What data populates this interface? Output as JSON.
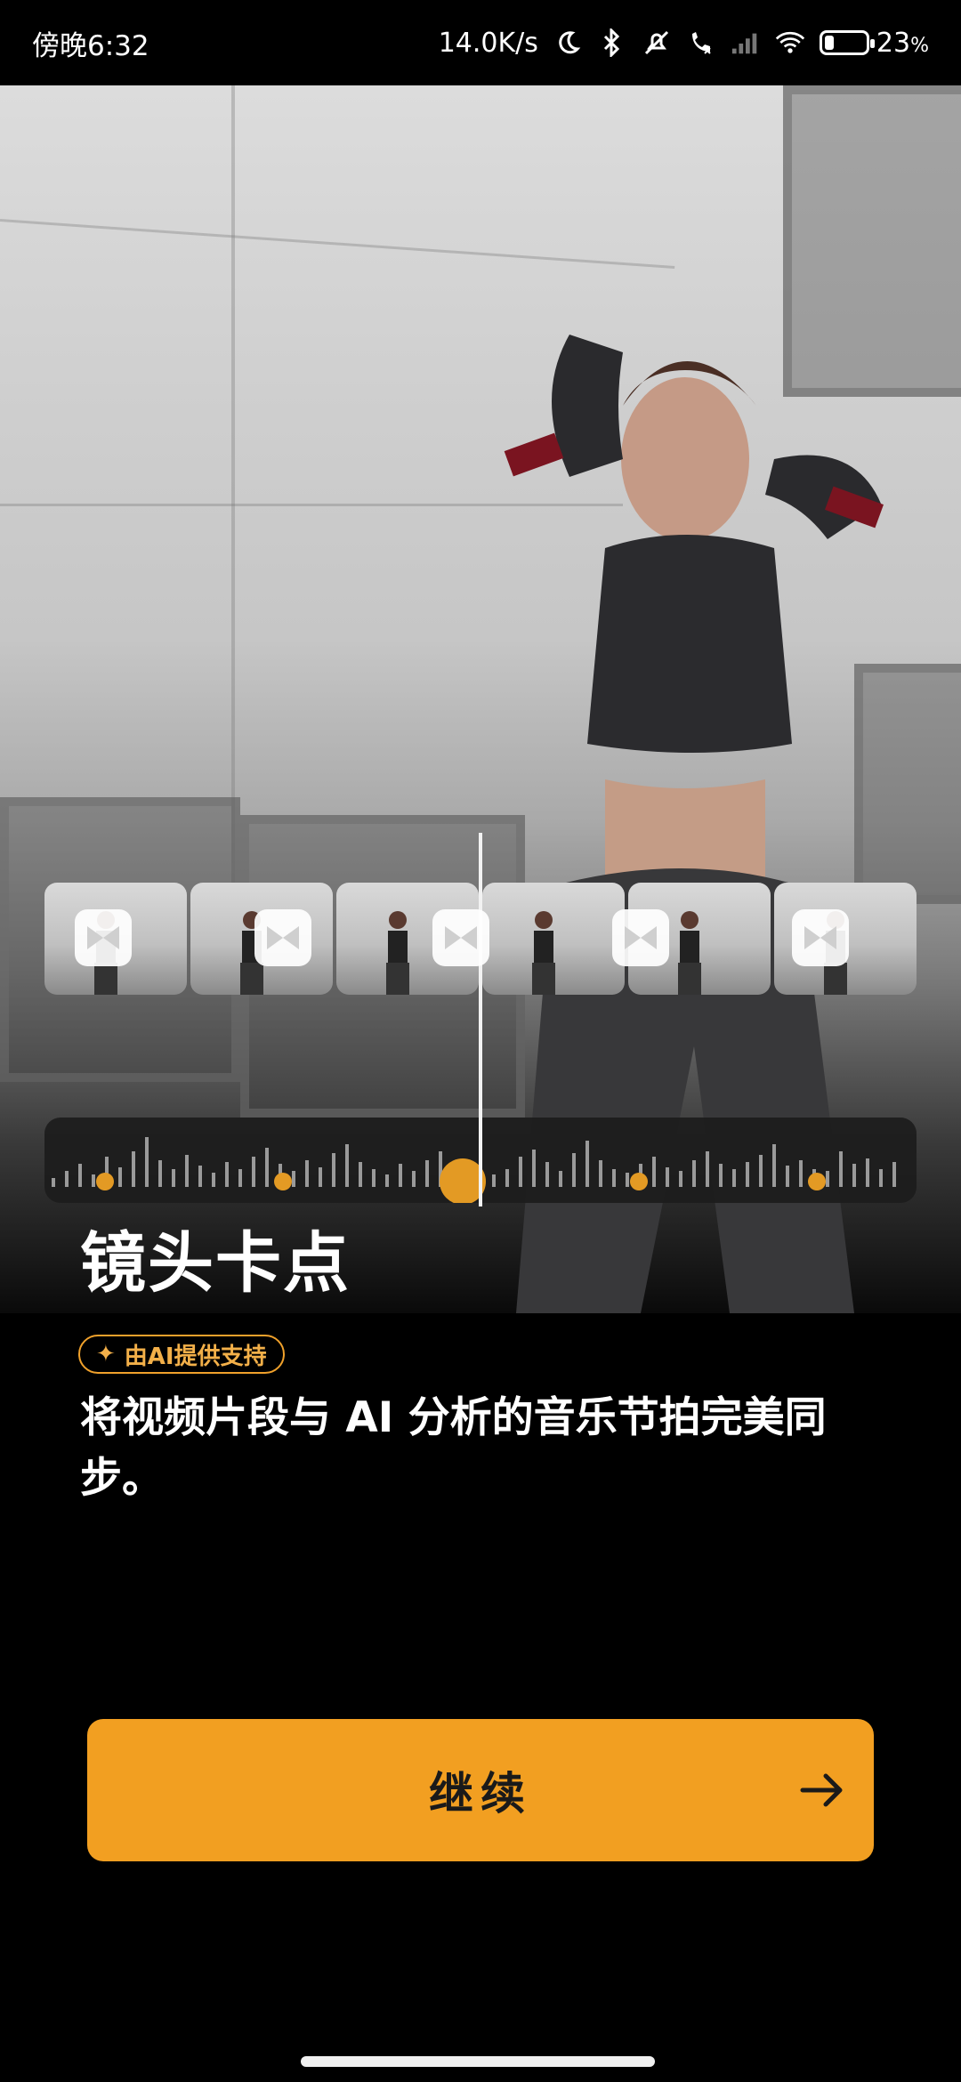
{
  "status_bar": {
    "time": "傍晚6:32",
    "network_speed": "14.0K/s",
    "battery_percent": "23",
    "battery_unit": "%",
    "battery_level": 0.23,
    "icons": [
      "moon-icon",
      "bluetooth-icon",
      "mute-icon",
      "call-icon",
      "signal-off-icon",
      "wifi-icon",
      "battery-icon"
    ]
  },
  "hero": {
    "clips_count_label": "",
    "transition_icon": "bowtie-transition-icon"
  },
  "feature": {
    "title": "镜头卡点",
    "badge_icon": "✦",
    "badge_label": "由AI提供支持",
    "description": "将视频片段与 AI 分析的音乐节拍完美同步。"
  },
  "cta": {
    "label": "继续",
    "arrow_icon": "arrow-right-icon"
  },
  "colors": {
    "accent": "#f29f21",
    "badge": "#f0a12b",
    "background": "#000000"
  }
}
